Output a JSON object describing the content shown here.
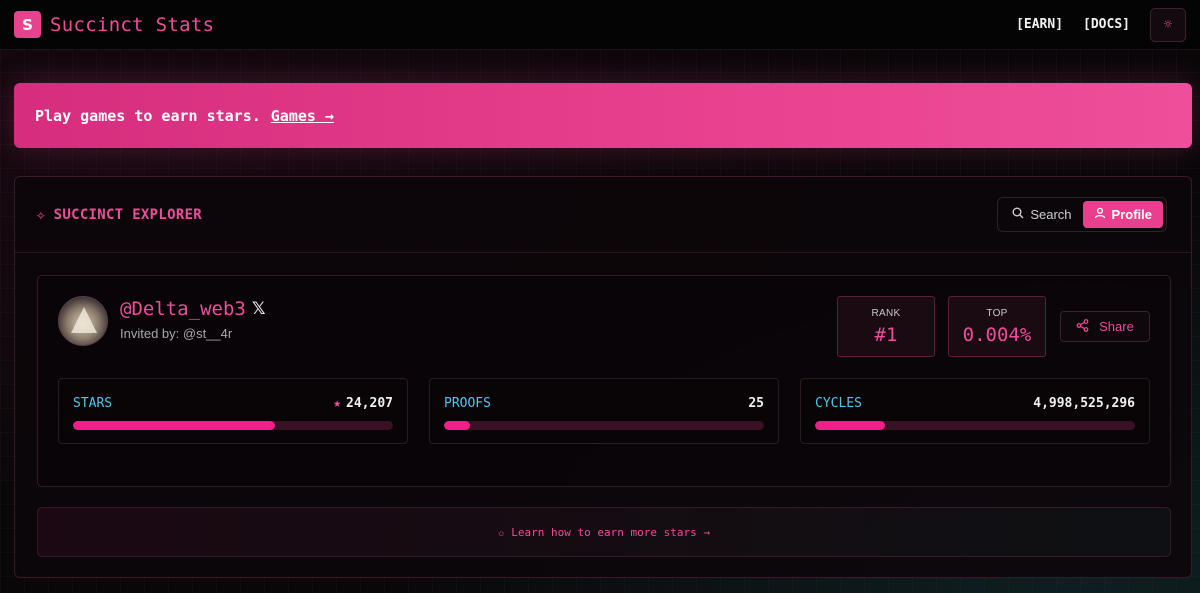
{
  "header": {
    "logo_letter": "S",
    "title": "Succinct Stats",
    "nav": {
      "earn": "[EARN]",
      "docs": "[DOCS]"
    },
    "theme_icon": "sun-icon"
  },
  "banner": {
    "text": "Play games to earn stars.",
    "link": "Games →"
  },
  "explorer": {
    "title": "SUCCINCT EXPLORER",
    "title_icon": "sparkle-icon",
    "tabs": {
      "search": "Search",
      "profile": "Profile"
    },
    "active_tab": "profile"
  },
  "profile": {
    "handle": "@Delta_web3",
    "social_icon": "x-icon",
    "invited_by": "Invited by: @st__4r",
    "rank": {
      "label": "RANK",
      "value": "#1"
    },
    "top": {
      "label": "TOP",
      "value": "0.004%"
    },
    "share_label": "Share"
  },
  "metrics": [
    {
      "label": "STARS",
      "value": "24,207",
      "progress": 0.63
    },
    {
      "label": "PROOFS",
      "value": "25",
      "progress": 0.08
    },
    {
      "label": "CYCLES",
      "value": "4,998,525,296",
      "progress": 0.22
    }
  ],
  "footer": {
    "learn_text": "✩ Learn how to earn more stars →"
  },
  "colors": {
    "accent": "#ea3f8f",
    "metric_label": "#4fc8ee",
    "bar_fill": "#f21f8a",
    "bar_track": "#3a1024"
  }
}
